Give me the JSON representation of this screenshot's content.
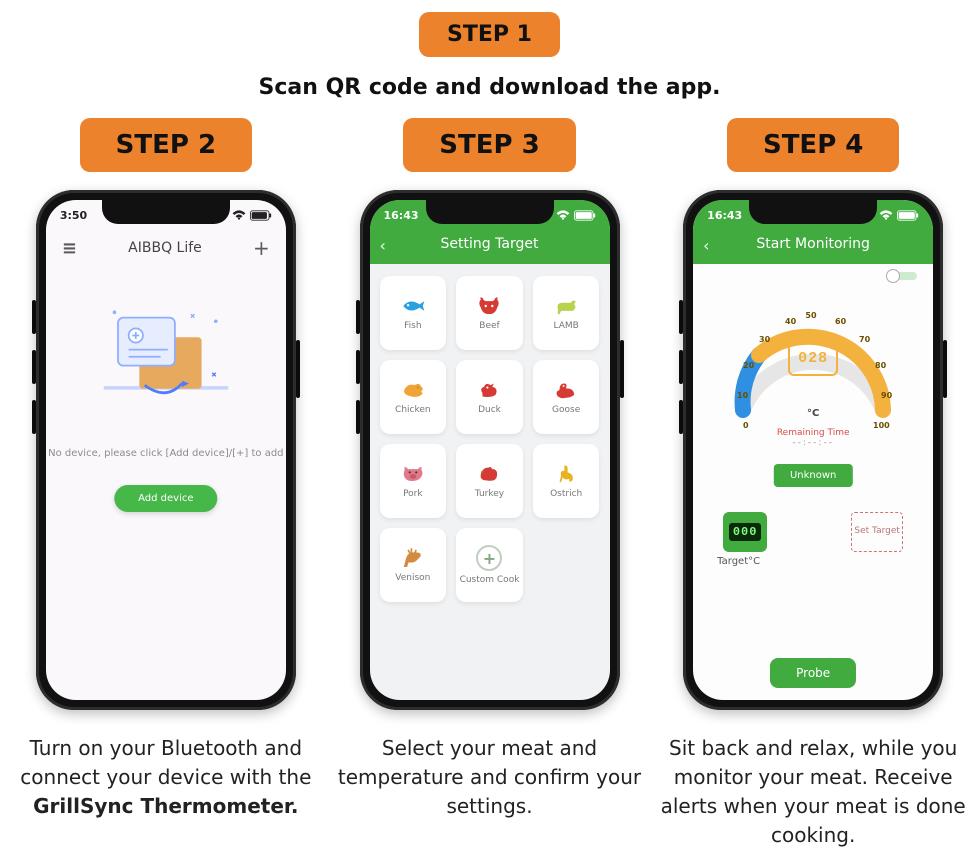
{
  "top": {
    "step_label": "STEP 1",
    "subtitle": "Scan QR code and download the app."
  },
  "cols": [
    {
      "step_label": "STEP 2",
      "phone": {
        "statusbar_time": "3:50",
        "app_title": "AIBBQ Life",
        "no_device_msg": "No device, please click [Add device]/[+] to add",
        "add_btn": "Add device"
      },
      "caption_pre": "Turn on your Bluetooth and connect your device with the ",
      "caption_bold": "GrillSync Thermometer."
    },
    {
      "step_label": "STEP 3",
      "phone": {
        "statusbar_time": "16:43",
        "header_title": "Setting Target",
        "tiles": [
          "Fish",
          "Beef",
          "LAMB",
          "Chicken",
          "Duck",
          "Goose",
          "Pork",
          "Turkey",
          "Ostrich",
          "Venison",
          "Custom Cook"
        ]
      },
      "caption": "Select your meat and temperature and confirm your settings."
    },
    {
      "step_label": "STEP 4",
      "phone": {
        "statusbar_time": "16:43",
        "header_title": "Start Monitoring",
        "gauge": {
          "display": "028",
          "unit": "°C",
          "ticks": [
            "0",
            "10",
            "20",
            "30",
            "40",
            "50",
            "60",
            "70",
            "80",
            "90",
            "100"
          ],
          "remaining_label": "Remaining Time",
          "remaining_value": "--:--:--"
        },
        "unknown_btn": "Unknown",
        "target_value": "000",
        "target_label": "Target°C",
        "set_target_btn": "Set Target",
        "probe_btn": "Probe"
      },
      "caption": "Sit back and relax, while you monitor your meat. Receive alerts when your meat is done cooking."
    }
  ],
  "icon_colors": {
    "fish": "#29a0e0",
    "beef": "#d63a35",
    "lamb": "#b8d24d",
    "chicken": "#f1a336",
    "duck": "#d63a35",
    "goose": "#d63a35",
    "pork": "#e07a8b",
    "turkey": "#d63a35",
    "ostrich": "#e8b321",
    "venison": "#d38b3f"
  }
}
